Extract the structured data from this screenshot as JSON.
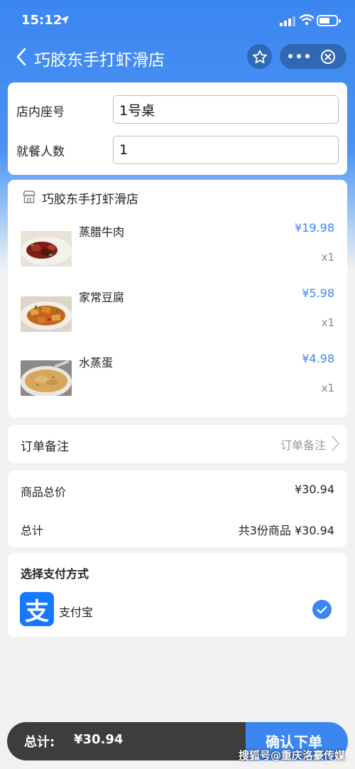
{
  "status_bar": {
    "time": "15:12"
  },
  "nav": {
    "title": "巧胶东手打虾滑店"
  },
  "seat": {
    "table_label": "店内座号",
    "table_value": "1号桌",
    "people_label": "就餐人数",
    "people_value": "1"
  },
  "shop": {
    "name": "巧胶东手打虾滑店",
    "items": [
      {
        "name": "蒸腊牛肉",
        "price": "¥19.98",
        "qty": "x1"
      },
      {
        "name": "家常豆腐",
        "price": "¥5.98",
        "qty": "x1"
      },
      {
        "name": "水蒸蛋",
        "price": "¥4.98",
        "qty": "x1"
      }
    ]
  },
  "note": {
    "label": "订单备注",
    "placeholder": "订单备注"
  },
  "summary": {
    "goods_total_label": "商品总价",
    "goods_total_value": "¥30.94",
    "total_label": "总计",
    "total_value": "共3份商品 ¥30.94"
  },
  "payment": {
    "title": "选择支付方式",
    "method": "支付宝",
    "logo_char": "支",
    "selected": true
  },
  "bottom": {
    "total_label": "总计:",
    "total_value": "¥30.94",
    "confirm_label": "确认下单"
  },
  "watermark": "搜狐号@重庆洛豪传媒",
  "colors": {
    "accent": "#3b86f0",
    "alipay": "#1677ff",
    "bottom_bar": "#3d3d3d"
  }
}
